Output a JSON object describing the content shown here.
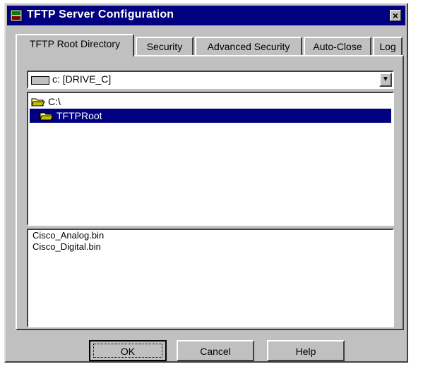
{
  "window": {
    "title": "TFTP Server Configuration",
    "close_glyph": "×"
  },
  "tabs": [
    {
      "label": "TFTP Root Directory",
      "active": true
    },
    {
      "label": "Security",
      "active": false
    },
    {
      "label": "Advanced Security",
      "active": false
    },
    {
      "label": "Auto-Close",
      "active": false
    },
    {
      "label": "Log",
      "active": false
    }
  ],
  "drive": {
    "label": "c: [DRIVE_C]",
    "icon": "drive-icon"
  },
  "directories": [
    {
      "label": "C:\\",
      "icon": "folder-open-icon",
      "selected": false
    },
    {
      "label": "TFTPRoot",
      "icon": "folder-open-icon",
      "selected": true
    }
  ],
  "files": [
    "Cisco_Analog.bin",
    "Cisco_Digital.bin"
  ],
  "buttons": {
    "ok": "OK",
    "cancel": "Cancel",
    "help": "Help"
  },
  "colors": {
    "titlebar": "#000080",
    "face": "#c0c0c0",
    "selection": "#000080"
  }
}
